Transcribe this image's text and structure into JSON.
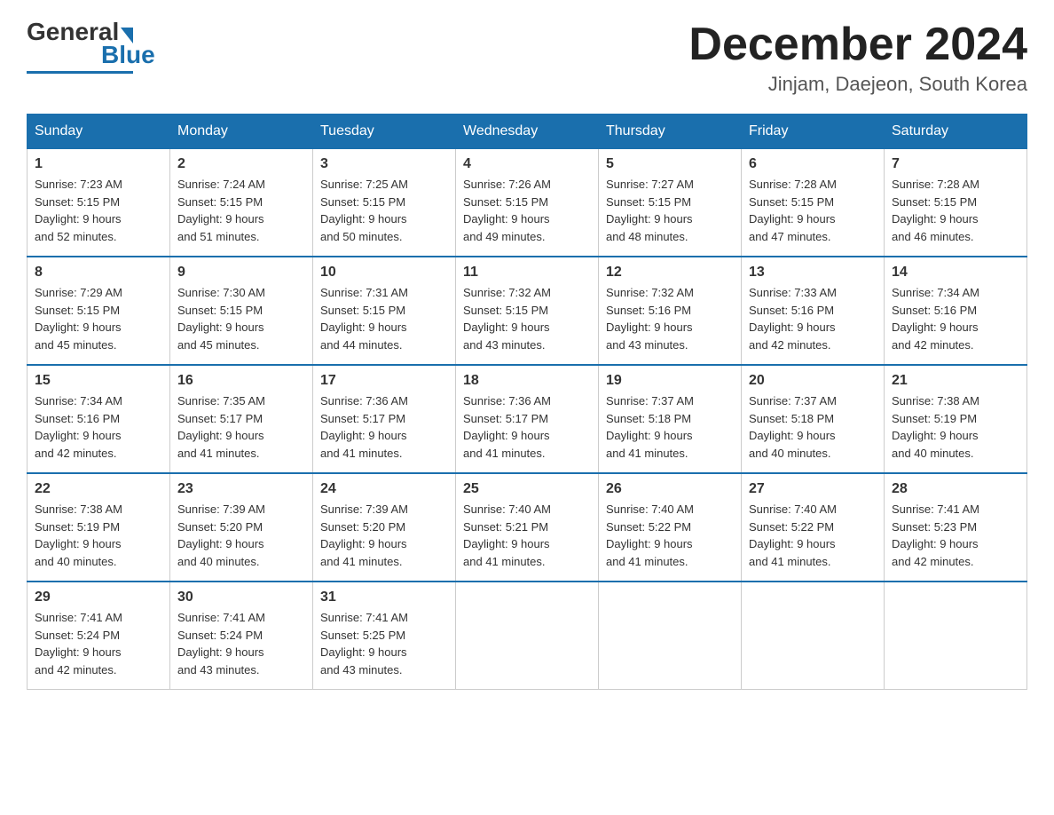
{
  "header": {
    "logo_general": "General",
    "logo_blue": "Blue",
    "month_title": "December 2024",
    "location": "Jinjam, Daejeon, South Korea"
  },
  "weekdays": [
    "Sunday",
    "Monday",
    "Tuesday",
    "Wednesday",
    "Thursday",
    "Friday",
    "Saturday"
  ],
  "weeks": [
    [
      {
        "day": "1",
        "sunrise": "7:23 AM",
        "sunset": "5:15 PM",
        "daylight": "9 hours and 52 minutes."
      },
      {
        "day": "2",
        "sunrise": "7:24 AM",
        "sunset": "5:15 PM",
        "daylight": "9 hours and 51 minutes."
      },
      {
        "day": "3",
        "sunrise": "7:25 AM",
        "sunset": "5:15 PM",
        "daylight": "9 hours and 50 minutes."
      },
      {
        "day": "4",
        "sunrise": "7:26 AM",
        "sunset": "5:15 PM",
        "daylight": "9 hours and 49 minutes."
      },
      {
        "day": "5",
        "sunrise": "7:27 AM",
        "sunset": "5:15 PM",
        "daylight": "9 hours and 48 minutes."
      },
      {
        "day": "6",
        "sunrise": "7:28 AM",
        "sunset": "5:15 PM",
        "daylight": "9 hours and 47 minutes."
      },
      {
        "day": "7",
        "sunrise": "7:28 AM",
        "sunset": "5:15 PM",
        "daylight": "9 hours and 46 minutes."
      }
    ],
    [
      {
        "day": "8",
        "sunrise": "7:29 AM",
        "sunset": "5:15 PM",
        "daylight": "9 hours and 45 minutes."
      },
      {
        "day": "9",
        "sunrise": "7:30 AM",
        "sunset": "5:15 PM",
        "daylight": "9 hours and 45 minutes."
      },
      {
        "day": "10",
        "sunrise": "7:31 AM",
        "sunset": "5:15 PM",
        "daylight": "9 hours and 44 minutes."
      },
      {
        "day": "11",
        "sunrise": "7:32 AM",
        "sunset": "5:15 PM",
        "daylight": "9 hours and 43 minutes."
      },
      {
        "day": "12",
        "sunrise": "7:32 AM",
        "sunset": "5:16 PM",
        "daylight": "9 hours and 43 minutes."
      },
      {
        "day": "13",
        "sunrise": "7:33 AM",
        "sunset": "5:16 PM",
        "daylight": "9 hours and 42 minutes."
      },
      {
        "day": "14",
        "sunrise": "7:34 AM",
        "sunset": "5:16 PM",
        "daylight": "9 hours and 42 minutes."
      }
    ],
    [
      {
        "day": "15",
        "sunrise": "7:34 AM",
        "sunset": "5:16 PM",
        "daylight": "9 hours and 42 minutes."
      },
      {
        "day": "16",
        "sunrise": "7:35 AM",
        "sunset": "5:17 PM",
        "daylight": "9 hours and 41 minutes."
      },
      {
        "day": "17",
        "sunrise": "7:36 AM",
        "sunset": "5:17 PM",
        "daylight": "9 hours and 41 minutes."
      },
      {
        "day": "18",
        "sunrise": "7:36 AM",
        "sunset": "5:17 PM",
        "daylight": "9 hours and 41 minutes."
      },
      {
        "day": "19",
        "sunrise": "7:37 AM",
        "sunset": "5:18 PM",
        "daylight": "9 hours and 41 minutes."
      },
      {
        "day": "20",
        "sunrise": "7:37 AM",
        "sunset": "5:18 PM",
        "daylight": "9 hours and 40 minutes."
      },
      {
        "day": "21",
        "sunrise": "7:38 AM",
        "sunset": "5:19 PM",
        "daylight": "9 hours and 40 minutes."
      }
    ],
    [
      {
        "day": "22",
        "sunrise": "7:38 AM",
        "sunset": "5:19 PM",
        "daylight": "9 hours and 40 minutes."
      },
      {
        "day": "23",
        "sunrise": "7:39 AM",
        "sunset": "5:20 PM",
        "daylight": "9 hours and 40 minutes."
      },
      {
        "day": "24",
        "sunrise": "7:39 AM",
        "sunset": "5:20 PM",
        "daylight": "9 hours and 41 minutes."
      },
      {
        "day": "25",
        "sunrise": "7:40 AM",
        "sunset": "5:21 PM",
        "daylight": "9 hours and 41 minutes."
      },
      {
        "day": "26",
        "sunrise": "7:40 AM",
        "sunset": "5:22 PM",
        "daylight": "9 hours and 41 minutes."
      },
      {
        "day": "27",
        "sunrise": "7:40 AM",
        "sunset": "5:22 PM",
        "daylight": "9 hours and 41 minutes."
      },
      {
        "day": "28",
        "sunrise": "7:41 AM",
        "sunset": "5:23 PM",
        "daylight": "9 hours and 42 minutes."
      }
    ],
    [
      {
        "day": "29",
        "sunrise": "7:41 AM",
        "sunset": "5:24 PM",
        "daylight": "9 hours and 42 minutes."
      },
      {
        "day": "30",
        "sunrise": "7:41 AM",
        "sunset": "5:24 PM",
        "daylight": "9 hours and 43 minutes."
      },
      {
        "day": "31",
        "sunrise": "7:41 AM",
        "sunset": "5:25 PM",
        "daylight": "9 hours and 43 minutes."
      },
      null,
      null,
      null,
      null
    ]
  ],
  "labels": {
    "sunrise": "Sunrise:",
    "sunset": "Sunset:",
    "daylight": "Daylight:"
  }
}
